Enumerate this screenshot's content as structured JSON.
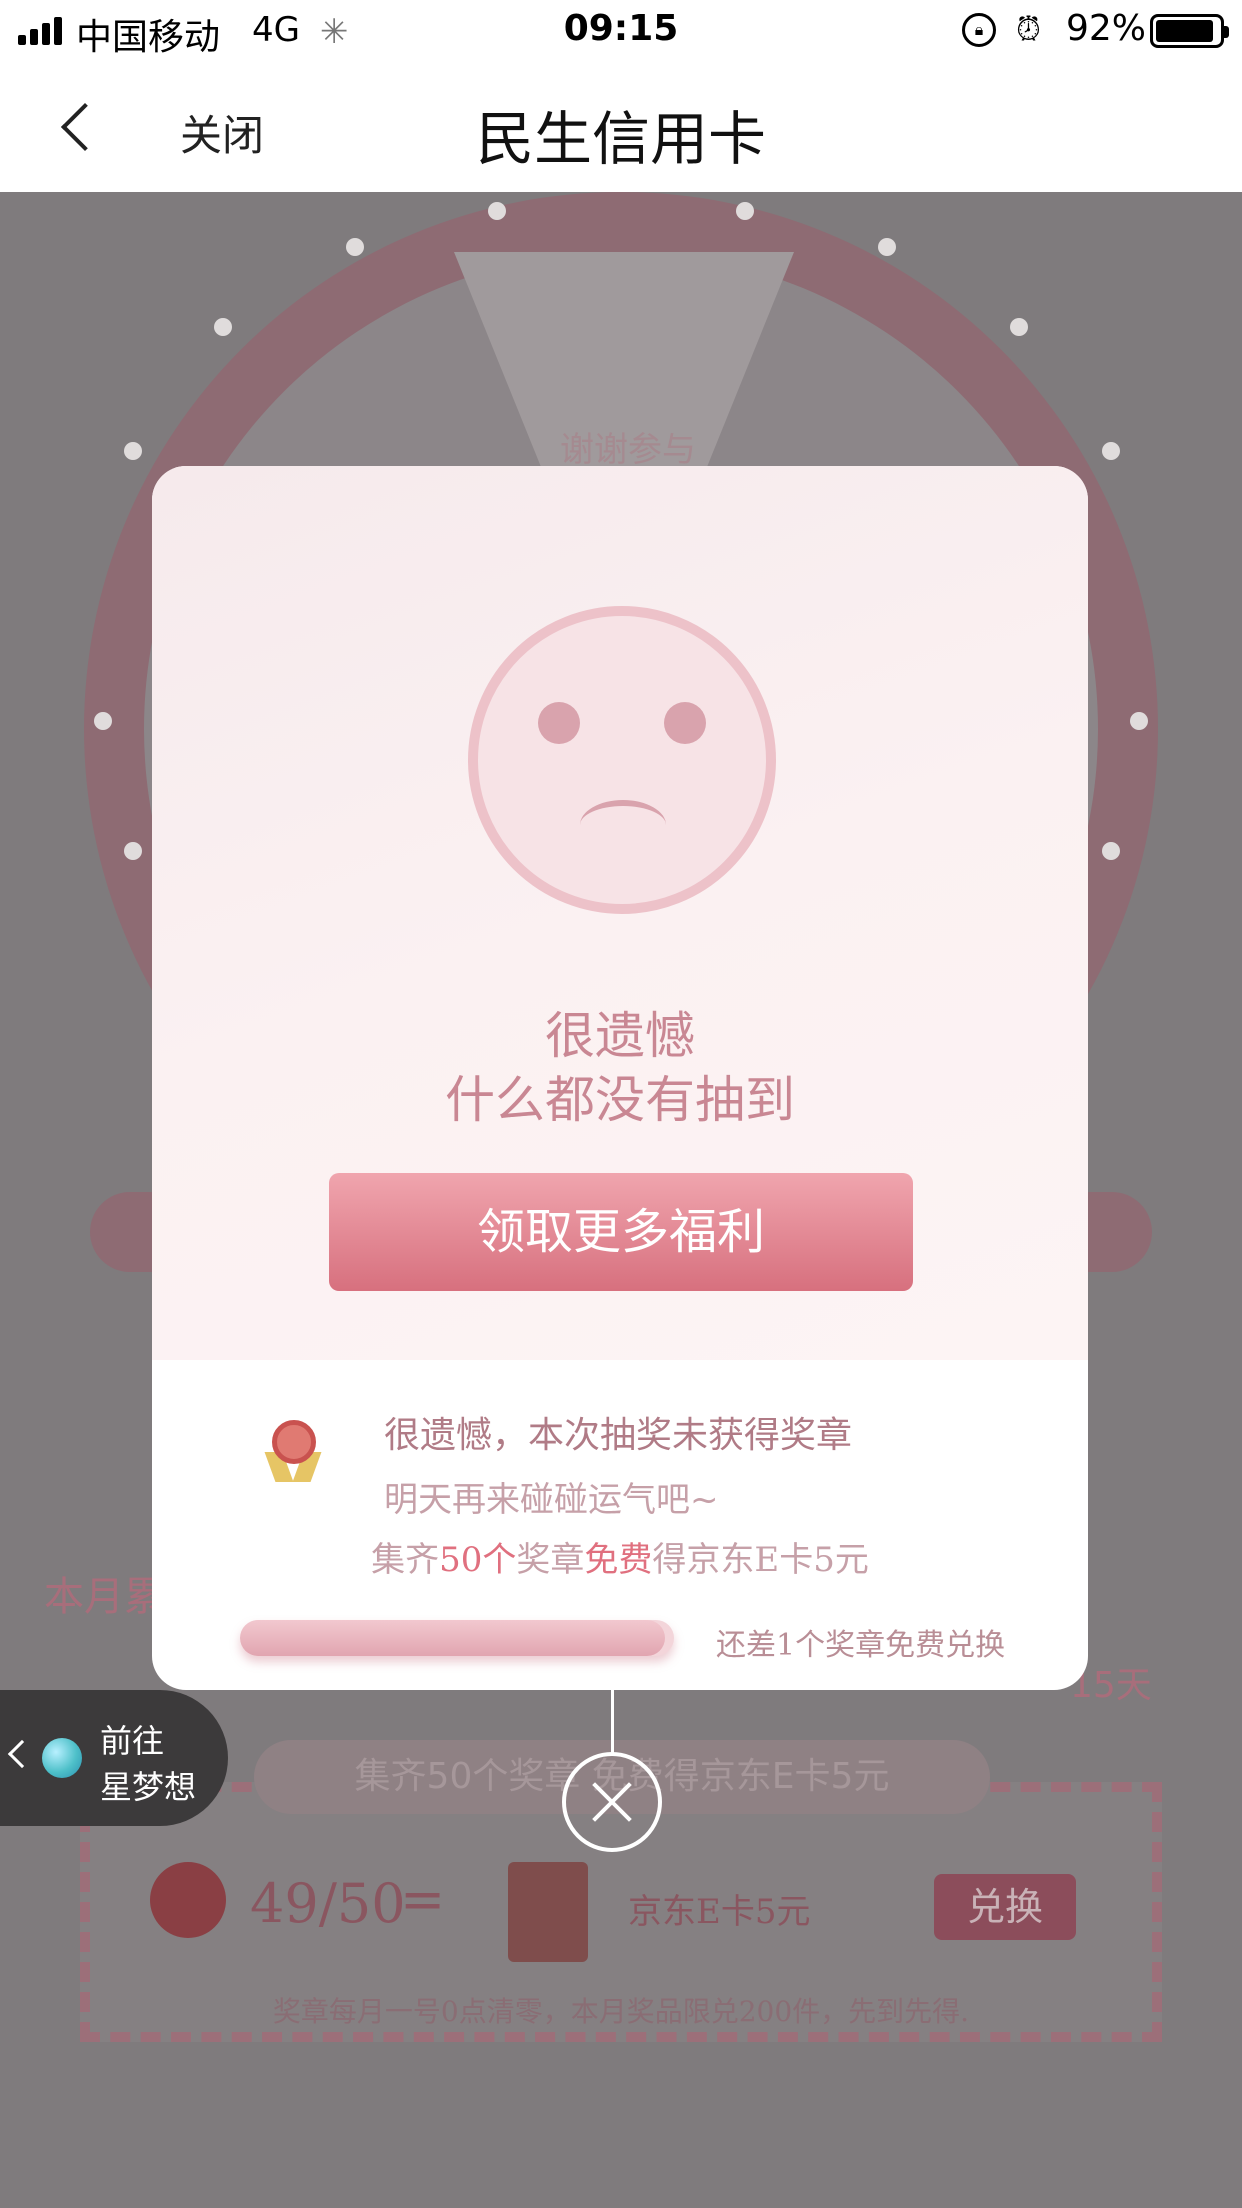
{
  "status_bar": {
    "carrier": "中国移动",
    "network": "4G",
    "time": "09:15",
    "battery_percent": "92%",
    "battery_level": 0.92,
    "icons": [
      "signal-icon",
      "loading-icon",
      "rotation-lock-icon",
      "alarm-icon",
      "battery-icon"
    ]
  },
  "nav": {
    "back_icon": "chevron-left-icon",
    "close_label": "关闭",
    "title": "民生信用卡"
  },
  "background": {
    "wheel_segment_label": "谢谢参与",
    "monthly_text": "本月累",
    "days_text": "15天",
    "collect_pill": "集齐50个奖章 免费得京东E卡5元",
    "badge_count": "49/50",
    "equals": "=",
    "prize_name": "京东E卡5元",
    "redeem_label": "兑换",
    "note": "奖章每月一号0点清零，本月奖品限兑200件，先到先得."
  },
  "floating_pill": {
    "line1": "前往",
    "line2": "星梦想"
  },
  "modal": {
    "face_icon": "sad-face-icon",
    "sorry_line1": "很遗憾",
    "sorry_line2": "什么都没有抽到",
    "more_benefits_button": "领取更多福利",
    "badge_icon": "medal-icon",
    "message1": "很遗憾，本次抽奖未获得奖章",
    "message2": "明天再来碰碰运气吧~",
    "collect_prefix": "集齐",
    "collect_count": "50个",
    "collect_mid": "奖章",
    "collect_free": "免费",
    "collect_suffix": "得京东E卡5元",
    "progress_fraction": 0.98,
    "progress_note": "还差1个奖章免费兑换"
  },
  "close_button": {
    "icon": "close-circle-icon"
  },
  "colors": {
    "accent": "#d7707e",
    "text_pink": "#c98793",
    "highlight": "#e0707f"
  }
}
